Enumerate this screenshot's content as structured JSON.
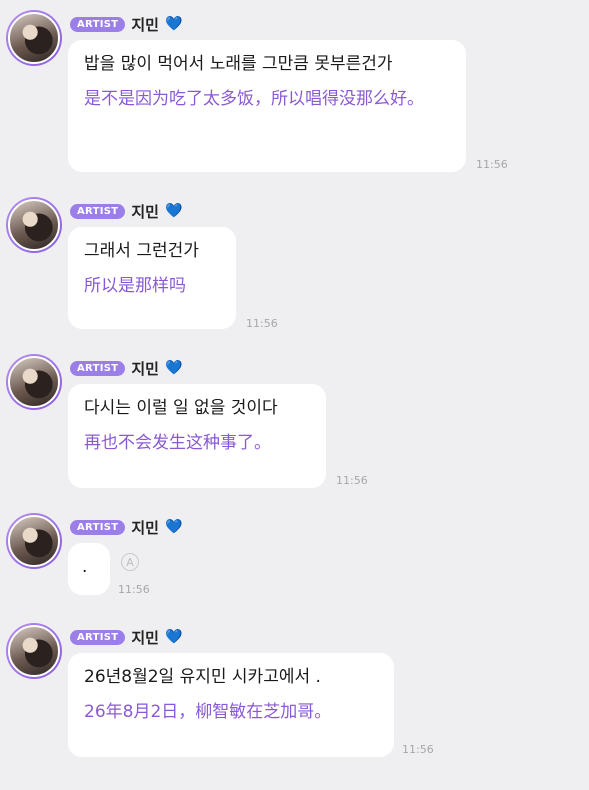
{
  "badge_label": "ARTIST",
  "artist_name": "지민",
  "heart_glyph": "💙",
  "messages": [
    {
      "korean": "밥을 많이 먹어서 노래를 그만큼 못부른건가",
      "chinese": "是不是因为吃了太多饭，所以唱得没那么好。",
      "time": "11:56"
    },
    {
      "korean": "그래서 그런건가",
      "chinese": "所以是那样吗",
      "time": "11:56"
    },
    {
      "korean": "다시는 이럴 일 없을 것이다",
      "chinese": "再也不会发生这种事了。",
      "time": "11:56"
    },
    {
      "korean": ".",
      "chinese": "",
      "time": "11:56"
    },
    {
      "korean": "26년8월2일 유지민 시카고에서 .",
      "chinese": "26年8月2日，柳智敏在芝加哥。",
      "time": "11:56"
    }
  ],
  "colors": {
    "badge": "#9b7ee8",
    "translation": "#8a5ad6",
    "background": "#efeff1"
  }
}
